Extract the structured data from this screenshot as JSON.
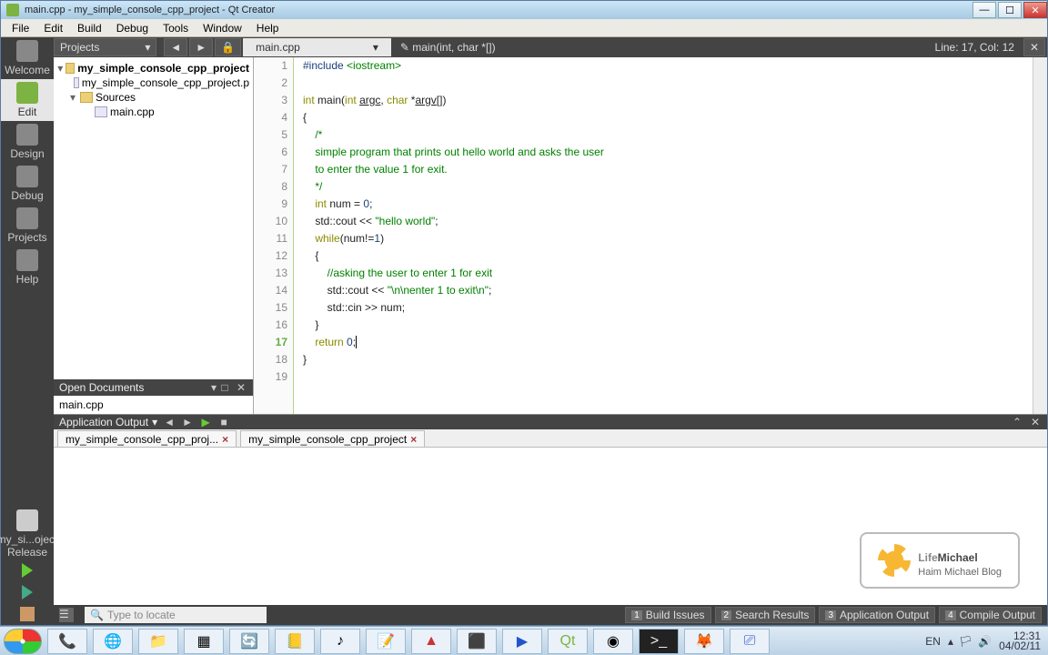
{
  "window": {
    "title": "main.cpp - my_simple_console_cpp_project - Qt Creator"
  },
  "menu": {
    "file": "File",
    "edit": "Edit",
    "build": "Build",
    "debug": "Debug",
    "tools": "Tools",
    "window": "Window",
    "help": "Help"
  },
  "sidebar": {
    "welcome": "Welcome",
    "edit": "Edit",
    "design": "Design",
    "debug": "Debug",
    "projects": "Projects",
    "help": "Help",
    "target_project": "my_si...oject",
    "target_mode": "Release"
  },
  "topstrip": {
    "combo": "Projects",
    "file_tab": "main.cpp",
    "crumb": "main(int, char *[])",
    "pos": "Line: 17, Col: 12"
  },
  "tree": {
    "root": "my_simple_console_cpp_project",
    "pro": "my_simple_console_cpp_project.p",
    "sources": "Sources",
    "main": "main.cpp"
  },
  "open_docs": {
    "header": "Open Documents",
    "item": "main.cpp"
  },
  "code": {
    "l1_a": "#include",
    "l1_b": " <iostream>",
    "l2": "",
    "l3_a": "int",
    "l3_b": " main(",
    "l3_c": "int",
    "l3_d": " ",
    "l3_e": "argc",
    "l3_f": ", ",
    "l3_g": "char",
    "l3_h": " *",
    "l3_i": "argv",
    "l3_j": "[])",
    "l4": "{",
    "l5": "    /*",
    "l6": "    simple program that prints out hello world and asks the user",
    "l7": "    to enter the value 1 for exit.",
    "l8": "    */",
    "l9_a": "    ",
    "l9_b": "int",
    "l9_c": " num = ",
    "l9_d": "0",
    "l9_e": ";",
    "l10_a": "    std::cout << ",
    "l10_b": "\"hello world\"",
    "l10_c": ";",
    "l11_a": "    ",
    "l11_b": "while",
    "l11_c": "(num!=",
    "l11_d": "1",
    "l11_e": ")",
    "l12": "    {",
    "l13_a": "        ",
    "l13_b": "//asking the user to enter 1 for exit",
    "l14_a": "        std::cout << ",
    "l14_b": "\"\\n\\nenter 1 to exit\\n\"",
    "l14_c": ";",
    "l15": "        std::cin >> num;",
    "l16": "    }",
    "l17_a": "    ",
    "l17_b": "return",
    "l17_c": " ",
    "l17_d": "0",
    "l17_e": ";",
    "l18": "}",
    "l19": ""
  },
  "lines": {
    "n1": "1",
    "n2": "2",
    "n3": "3",
    "n4": "4",
    "n5": "5",
    "n6": "6",
    "n7": "7",
    "n8": "8",
    "n9": "9",
    "n10": "10",
    "n11": "11",
    "n12": "12",
    "n13": "13",
    "n14": "14",
    "n15": "15",
    "n16": "16",
    "n17": "17",
    "n18": "18",
    "n19": "19"
  },
  "output": {
    "header": "Application Output",
    "tab1": "my_simple_console_cpp_proj...",
    "tab2": "my_simple_console_cpp_project"
  },
  "brand": {
    "name_a": "Life",
    "name_b": "Michael",
    "sub": "Haim Michael Blog"
  },
  "status": {
    "locate": "Type to locate",
    "t1": "Build Issues",
    "t2": "Search Results",
    "t3": "Application Output",
    "t4": "Compile Output",
    "n1": "1",
    "n2": "2",
    "n3": "3",
    "n4": "4"
  },
  "taskbar": {
    "lang": "EN",
    "time": "12:31",
    "date": "04/02/11"
  }
}
